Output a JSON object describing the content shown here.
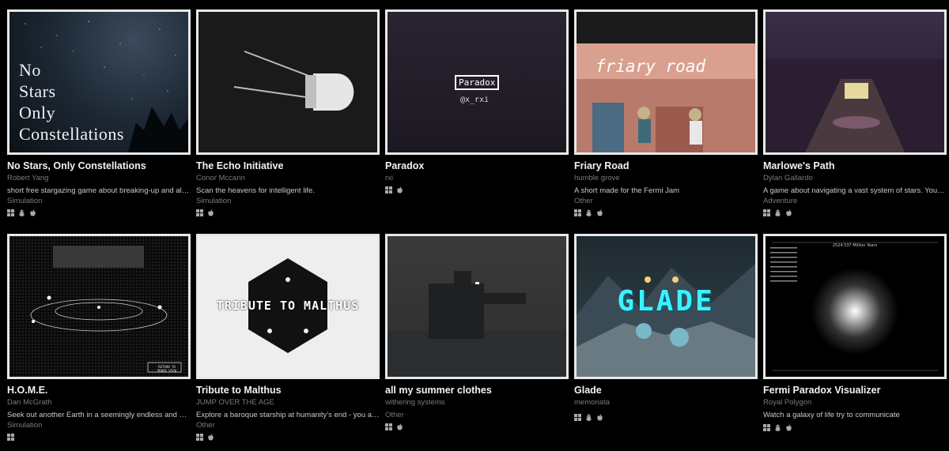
{
  "games": [
    {
      "title": "No Stars, Only Constellations",
      "author": "Robert Yang",
      "desc": "short free stargazing game about breaking-up and alien...",
      "genre": "Simulation",
      "platforms": [
        "windows-icon",
        "linux-icon",
        "apple-icon"
      ],
      "cover": {
        "lines": [
          "No",
          "Stars",
          "Only",
          "Constellations"
        ]
      }
    },
    {
      "title": "The Echo Initiative",
      "author": "Conor Mccann",
      "desc": "Scan the heavens for intelligent life.",
      "genre": "Simulation",
      "platforms": [
        "windows-icon",
        "apple-icon"
      ],
      "cover": {}
    },
    {
      "title": "Paradox",
      "author": "rxi",
      "desc": "",
      "genre": "",
      "platforms": [
        "windows-icon",
        "apple-icon"
      ],
      "cover": {
        "label": "Paradox",
        "handle": "@x_rxi"
      }
    },
    {
      "title": "Friary Road",
      "author": "humble grove",
      "desc": "A short made for the Fermi Jam",
      "genre": "Other",
      "platforms": [
        "windows-icon",
        "linux-icon",
        "apple-icon"
      ],
      "cover": {
        "label": "friary road"
      }
    },
    {
      "title": "Marlowe's Path",
      "author": "Dylan Gallardo",
      "desc": "A game about navigating a vast system of stars. You are...",
      "genre": "Adventure",
      "platforms": [
        "windows-icon",
        "linux-icon",
        "apple-icon"
      ],
      "cover": {}
    },
    {
      "title": "H.O.M.E.",
      "author": "Dan McGrath",
      "desc": "Seek out another Earth in a seemingly endless and dea...",
      "genre": "Simulation",
      "platforms": [
        "windows-icon"
      ],
      "cover": {
        "button": "RETURN TO PROBE VIEW"
      }
    },
    {
      "title": "Tribute to Malthus",
      "author": "JUMP OVER THE AGE",
      "desc": "Explore a baroque starship at humanity's end - you are ...",
      "genre": "Other",
      "platforms": [
        "windows-icon",
        "apple-icon"
      ],
      "cover": {
        "label": "TRIBUTE TO MALTHUS"
      }
    },
    {
      "title": "all my summer clothes",
      "author": "withering systems",
      "desc": "",
      "genre": "Other",
      "platforms": [
        "windows-icon",
        "apple-icon"
      ],
      "cover": {}
    },
    {
      "title": "Glade",
      "author": "memoriata",
      "desc": "",
      "genre": "",
      "platforms": [
        "windows-icon",
        "linux-icon",
        "apple-icon"
      ],
      "cover": {
        "label": "GLADE"
      }
    },
    {
      "title": "Fermi Paradox Visualizer",
      "author": "Royal Polygon",
      "desc": "Watch a galaxy of life try to communicate",
      "genre": "",
      "platforms": [
        "windows-icon",
        "linux-icon",
        "apple-icon"
      ],
      "cover": {
        "header": "2524.537 Million Years"
      }
    }
  ]
}
